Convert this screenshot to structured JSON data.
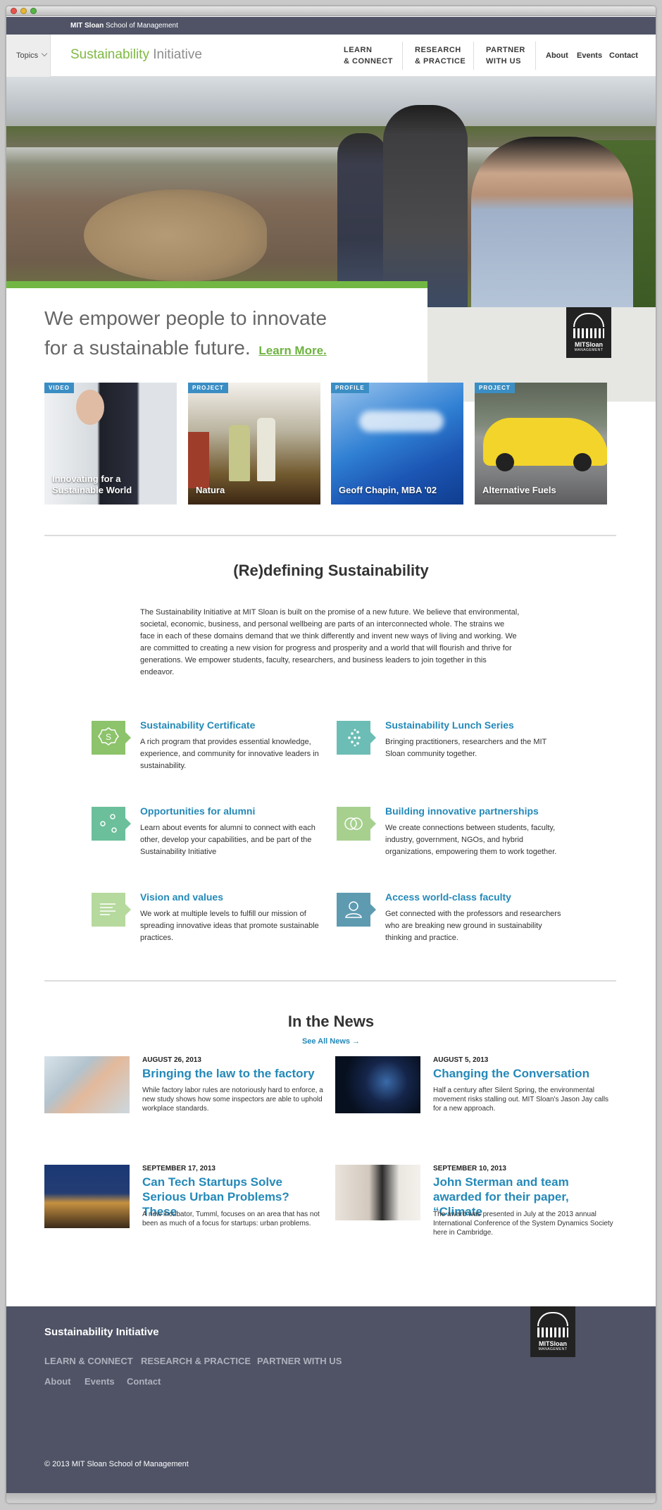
{
  "top_bar": {
    "brand_bold": "MIT Sloan",
    "brand_rest": " School of Management"
  },
  "nav": {
    "topics": "Topics",
    "site_title_a": "Sustainability",
    "site_title_b": " Initiative",
    "groups": [
      {
        "line1": "LEARN",
        "line2": "& CONNECT"
      },
      {
        "line1": "RESEARCH",
        "line2": "& PRACTICE"
      },
      {
        "line1": "PARTNER",
        "line2": "WITH US"
      }
    ],
    "small_links": [
      "About",
      "Events",
      "Contact"
    ]
  },
  "hero": {
    "tagline_line1": "We empower people to innovate",
    "tagline_line2": "for a sustainable future.",
    "learn_more": "Learn More.",
    "logo_text": "MITSloan",
    "logo_sub": "MANAGEMENT"
  },
  "cards": [
    {
      "badge": "VIDEO",
      "title": "Innovating for a Sustainable World"
    },
    {
      "badge": "PROJECT",
      "title": "Natura"
    },
    {
      "badge": "PROFILE",
      "title": "Geoff Chapin, MBA '02"
    },
    {
      "badge": "PROJECT",
      "title": "Alternative Fuels"
    }
  ],
  "redefining": {
    "heading": "(Re)defining Sustainability",
    "body": "The Sustainability Initiative at MIT Sloan is built on the promise of a new future. We believe that environmental, societal, economic, business, and personal wellbeing are parts of an interconnected whole. The strains we face in each of these domains demand that we think differently and invent new ways of living and working. We are committed to creating a new vision for progress and prosperity and a world that will flourish and thrive for generations.  We empower students, faculty, researchers, and business leaders to join together in this endeavor."
  },
  "features": [
    {
      "title": "Sustainability Certificate",
      "desc": "A rich program that provides essential knowledge, experience, and community for innovative leaders in sustainability.",
      "icon": "certificate-icon",
      "color": "#8dc36b"
    },
    {
      "title": "Sustainability Lunch Series",
      "desc": "Bringing practitioners, researchers and the MIT Sloan community together.",
      "icon": "dots-icon",
      "color": "#6cbdb5"
    },
    {
      "title": "Opportunities for alumni",
      "desc": "Learn about events for alumni to connect with each other, develop your capabilities, and be part of the Sustainability Initiative",
      "icon": "network-icon",
      "color": "#6bbf9b"
    },
    {
      "title": "Building innovative partnerships",
      "desc": "We create connections between students, faculty, industry, government, NGOs, and hybrid organizations, empowering them to work together.",
      "icon": "rings-icon",
      "color": "#a7d08f"
    },
    {
      "title": "Vision and values",
      "desc": "We work at multiple levels to fulfill our mission of spreading innovative ideas that promote sustainable practices.",
      "icon": "document-icon",
      "color": "#b6d99d"
    },
    {
      "title": "Access world-class faculty",
      "desc": "Get connected with the professors and researchers who are breaking new ground in sustainability thinking and practice.",
      "icon": "person-icon",
      "color": "#5e9bb1"
    }
  ],
  "news": {
    "heading": "In the News",
    "see_all": "See All News →",
    "items": [
      {
        "date": "AUGUST 26, 2013",
        "title": "Bringing the law to the factory",
        "desc": "While factory labor rules are notoriously hard to enforce, a new study shows how some inspectors are able to uphold workplace standards."
      },
      {
        "date": "AUGUST 5, 2013",
        "title": "Changing the Conversation",
        "desc": "Half a century after Silent Spring, the environmental movement risks stalling out. MIT Sloan's Jason Jay calls for a new approach."
      },
      {
        "date": "SEPTEMBER 17, 2013",
        "title": "Can Tech Startups Solve Serious Urban Problems? These",
        "desc": "A new incubator, Tumml, focuses on an area that has not been as much of a focus for startups: urban problems."
      },
      {
        "date": "SEPTEMBER 10, 2013",
        "title": "John Sterman and team awarded for their paper, “Climate",
        "desc": "The award was presented in July at the 2013 annual International Conference of the System Dynamics Society here in Cambridge."
      }
    ]
  },
  "footer": {
    "title": "Sustainability Initiative",
    "primary_links": [
      "LEARN & CONNECT",
      "RESEARCH & PRACTICE",
      "PARTNER WITH US"
    ],
    "secondary_links": [
      "About",
      "Events",
      "Contact"
    ],
    "copyright": "© 2013 MIT Sloan School of Management",
    "logo_text": "MITSloan",
    "logo_sub": "MANAGEMENT"
  }
}
